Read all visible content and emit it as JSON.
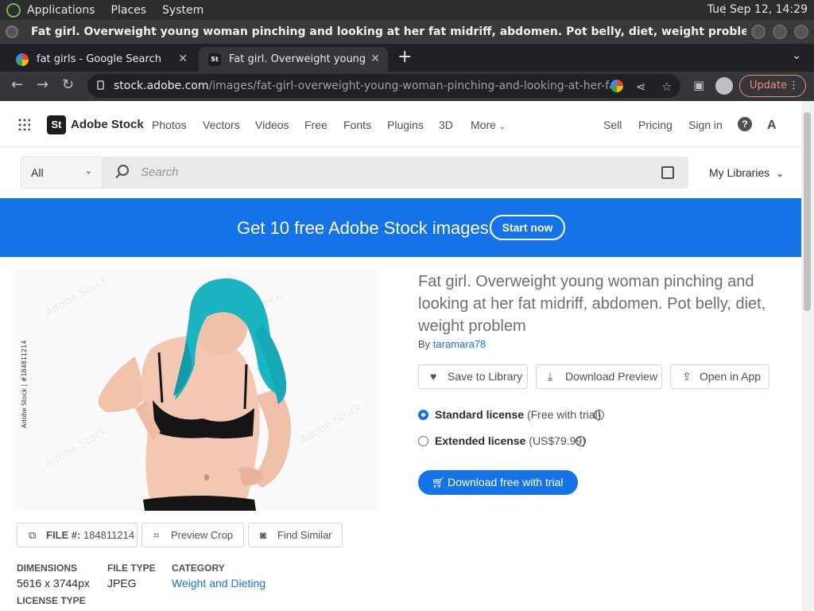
{
  "os": {
    "menus": [
      "Applications",
      "Places",
      "System"
    ],
    "clock": "Tue Sep 12, 14:29"
  },
  "window": {
    "title": "Fat girl. Overweight young woman pinching and looking at her fat midriff, abdomen. Pot belly, diet, weight problem Stock Photo | Adobe Stock ..."
  },
  "tabs": [
    {
      "label": "fat girls - Google Search",
      "favicon": "google-icon"
    },
    {
      "label": "Fat girl. Overweight young wo",
      "favicon": "adobe-stock-icon"
    }
  ],
  "browser": {
    "url_domain": "stock.adobe.com",
    "url_path": "/images/fat-girl-overweight-young-woman-pinching-and-looking-at-her-fat-m...",
    "update_label": "Update"
  },
  "stock_nav": {
    "logo_text": "St",
    "brand": "Adobe Stock",
    "links": [
      "Photos",
      "Vectors",
      "Videos",
      "Free",
      "Fonts",
      "Plugins",
      "3D",
      "More"
    ],
    "right_links": [
      "Sell",
      "Pricing",
      "Sign in"
    ]
  },
  "search": {
    "scope": "All",
    "placeholder": "Search",
    "my_libraries": "My Libraries"
  },
  "banner": {
    "message": "Get 10 free Adobe Stock images.",
    "cta": "Start now"
  },
  "asset": {
    "watermark": "Adobe Stock | #184811214",
    "title": "Fat girl. Overweight young woman pinching and looking at her fat midriff, abdomen. Pot belly, diet, weight problem",
    "by_prefix": "By",
    "author": "taramara78",
    "actions": [
      "Save to Library",
      "Download Preview",
      "Open in App"
    ],
    "licenses": [
      {
        "name": "Standard license",
        "note": "(Free with trial)",
        "selected": true
      },
      {
        "name": "Extended license",
        "note": "(US$79.99)",
        "selected": false
      }
    ],
    "download_cta": "Download free with trial",
    "file_label": "FILE #:",
    "file_id": "184811214",
    "preview_crop": "Preview Crop",
    "find_similar": "Find Similar",
    "meta": {
      "dimensions_label": "DIMENSIONS",
      "dimensions": "5616 x 3744px",
      "file_type_label": "FILE TYPE",
      "file_type": "JPEG",
      "category_label": "CATEGORY",
      "category": "Weight and Dieting",
      "license_type_label": "LICENSE TYPE"
    }
  },
  "colors": {
    "adobe_blue": "#1473e6",
    "chrome_dark": "#202124",
    "hair": "#1bb5c1"
  }
}
